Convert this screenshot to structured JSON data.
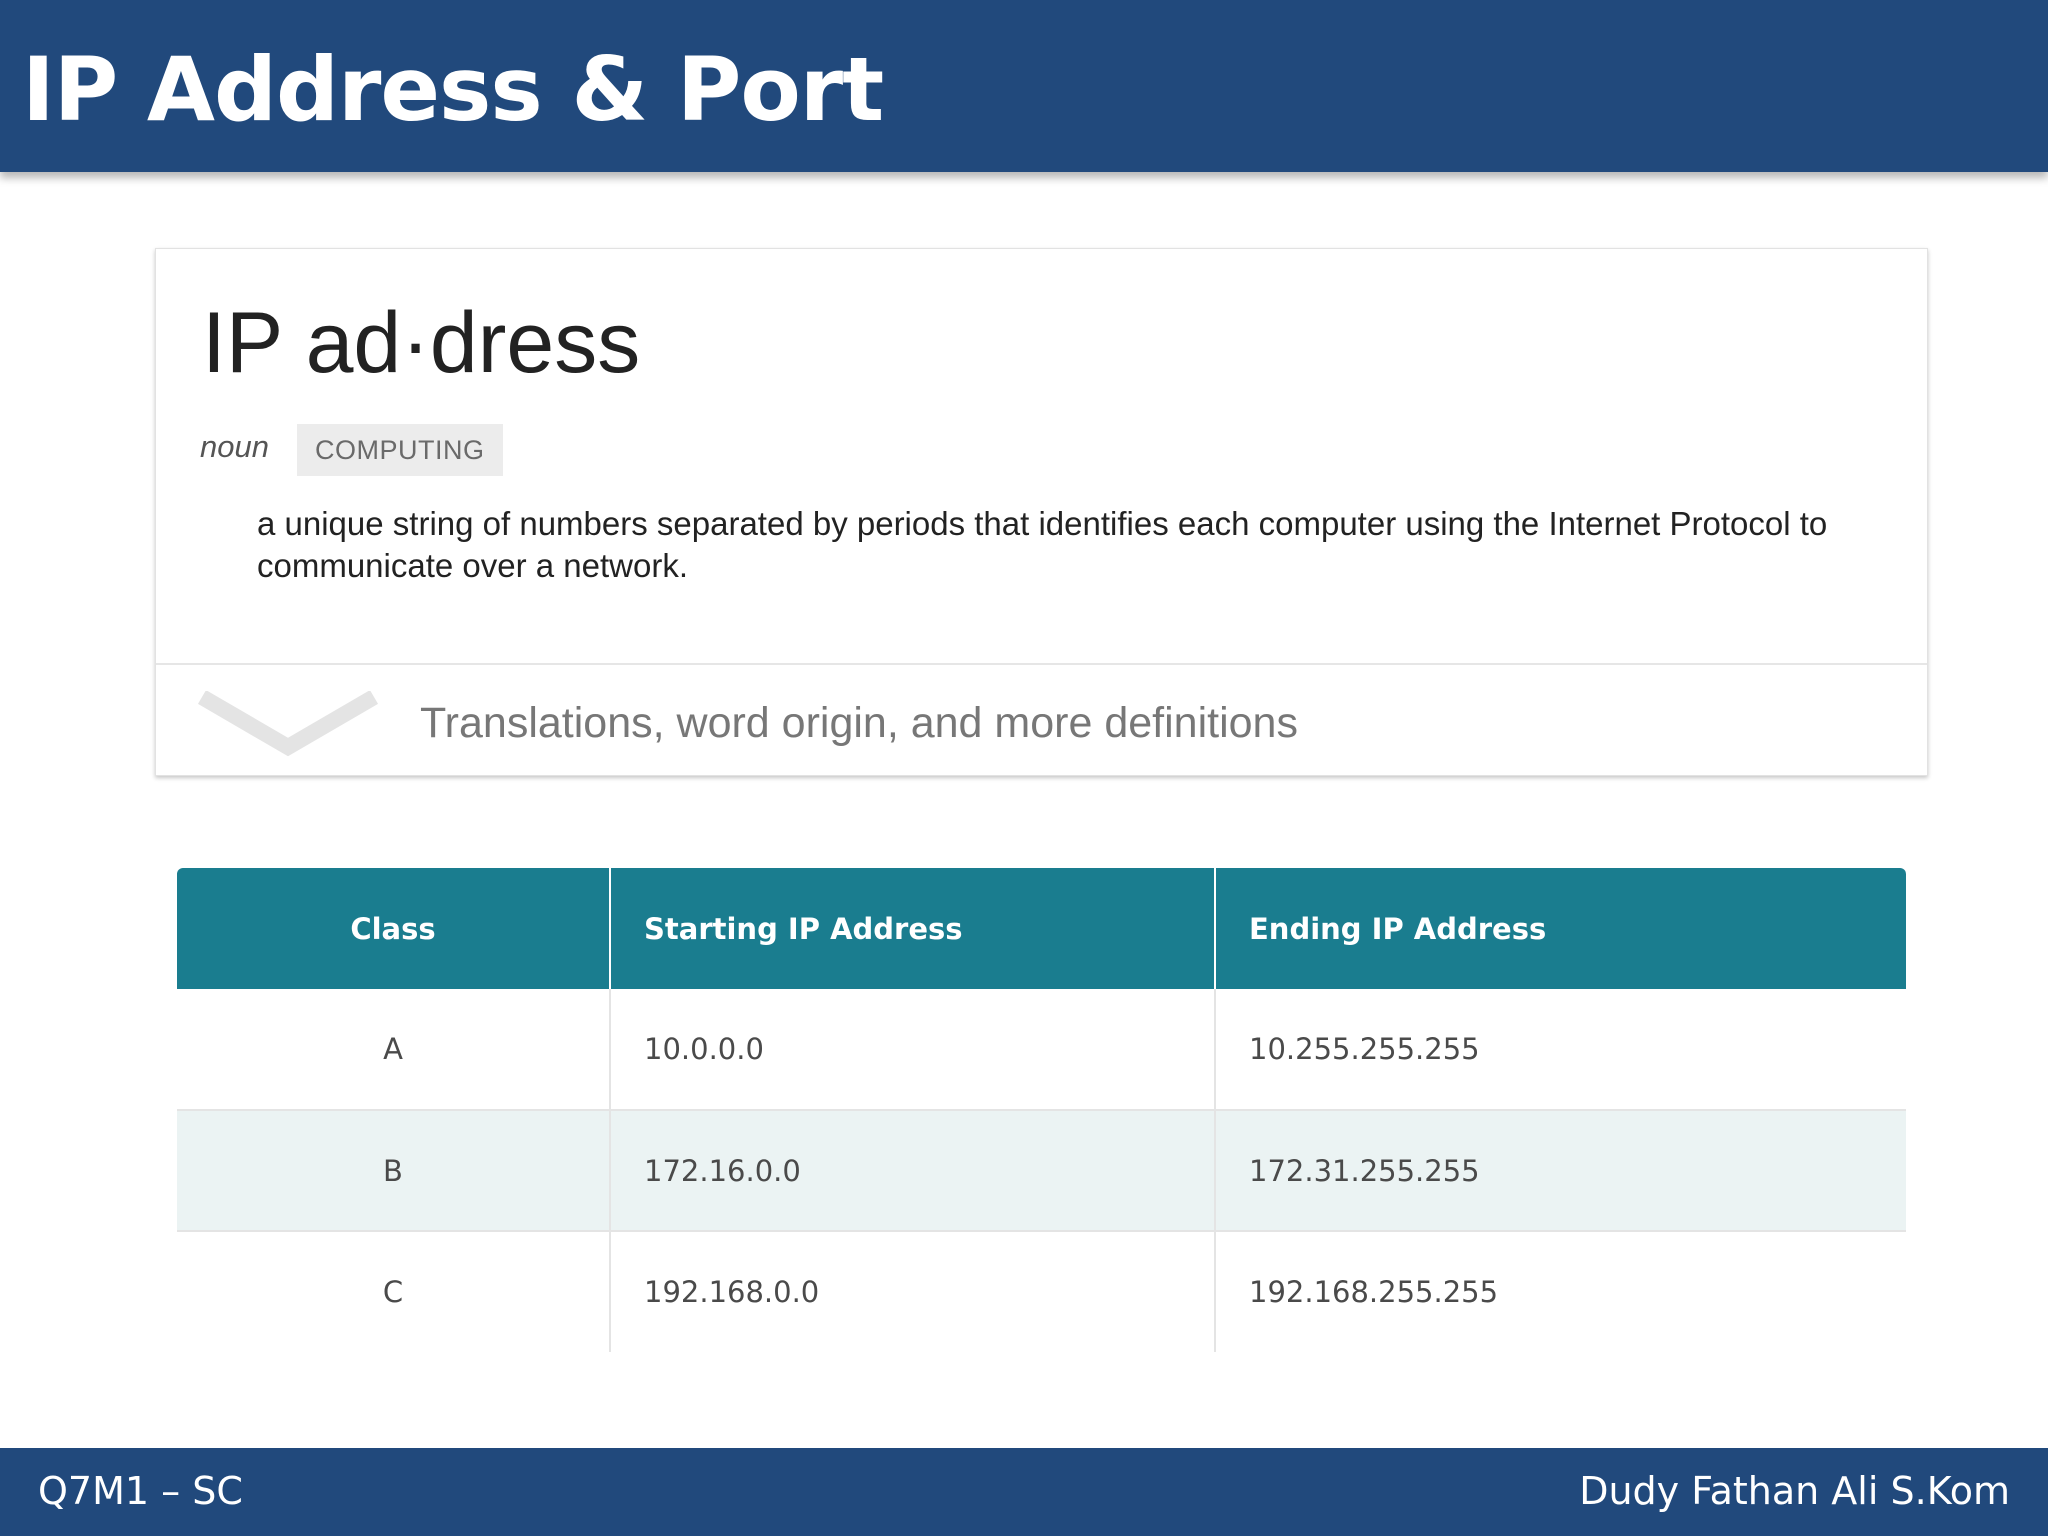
{
  "slide": {
    "title": "IP Address & Port"
  },
  "definition_card": {
    "word": "IP ad·dress",
    "part_of_speech": "noun",
    "tag": "COMPUTING",
    "definition": "a unique string of numbers separated by periods that identifies each computer using the Internet Protocol to communicate over a network.",
    "more_label": "Translations, word origin, and more definitions",
    "expand_icon": "chevron-down-icon"
  },
  "ip_table": {
    "headers": [
      "Class",
      "Starting IP Address",
      "Ending IP Address"
    ],
    "rows": [
      [
        "A",
        "10.0.0.0",
        "10.255.255.255"
      ],
      [
        "B",
        "172.16.0.0",
        "172.31.255.255"
      ],
      [
        "C",
        "192.168.0.0",
        "192.168.255.255"
      ]
    ]
  },
  "footer": {
    "left": "Q7M1 – SC",
    "right": "Dudy Fathan Ali S.Kom"
  },
  "colors": {
    "header_band": "#21497c",
    "table_header": "#1a7d8f",
    "table_alt_row": "#ebf3f3"
  }
}
